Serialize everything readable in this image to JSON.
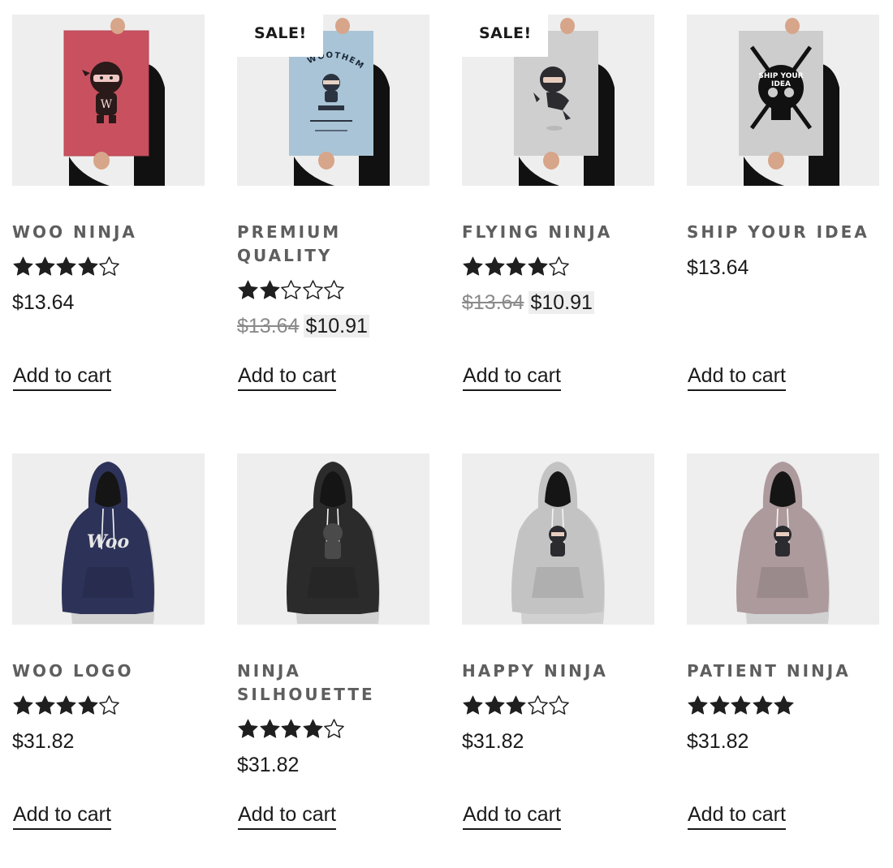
{
  "products": [
    {
      "title": "Woo Ninja",
      "rating": 4,
      "price": "$13.64",
      "old_price": "",
      "sale": "",
      "add_label": "Add to cart",
      "image": "poster-woo-ninja",
      "color": "#c9515f"
    },
    {
      "title": "Premium Quality",
      "rating": 2,
      "price": "$10.91",
      "old_price": "$13.64",
      "sale": "SALE!",
      "add_label": "Add to cart",
      "image": "poster-premium-quality",
      "color": "#a9c4d6"
    },
    {
      "title": "Flying Ninja",
      "rating": 4,
      "price": "$10.91",
      "old_price": "$13.64",
      "sale": "SALE!",
      "add_label": "Add to cart",
      "image": "poster-flying-ninja",
      "color": "#cfcfcf"
    },
    {
      "title": "Ship Your Idea",
      "rating": 0,
      "price": "$13.64",
      "old_price": "",
      "sale": "",
      "add_label": "Add to cart",
      "image": "poster-ship-your-idea",
      "color": "#cdcdcd"
    },
    {
      "title": "Woo Logo",
      "rating": 4,
      "price": "$31.82",
      "old_price": "",
      "sale": "",
      "add_label": "Add to cart",
      "image": "hoodie-woo-logo",
      "color": "#2d3358"
    },
    {
      "title": "Ninja Silhouette",
      "rating": 4,
      "price": "$31.82",
      "old_price": "",
      "sale": "",
      "add_label": "Add to cart",
      "image": "hoodie-ninja-silhouette",
      "color": "#2b2b2b"
    },
    {
      "title": "Happy Ninja",
      "rating": 3,
      "price": "$31.82",
      "old_price": "",
      "sale": "",
      "add_label": "Add to cart",
      "image": "hoodie-happy-ninja",
      "color": "#c3c3c3"
    },
    {
      "title": "Patient Ninja",
      "rating": 5,
      "price": "$31.82",
      "old_price": "",
      "sale": "",
      "add_label": "Add to cart",
      "image": "hoodie-patient-ninja",
      "color": "#ad9a9c"
    }
  ],
  "poster_text": {
    "woo_letter": "W",
    "woothemes": "WOOTHEMES",
    "ship_line1": "SHIP YOUR",
    "ship_line2": "IDEA",
    "woo_logo": "Woo"
  },
  "colors": {
    "star": "#1f1f1f",
    "title": "#5e5e5e",
    "text": "#1a1a1a",
    "old_price": "#8a8a8a",
    "thumb_bg": "#eeeeee"
  }
}
